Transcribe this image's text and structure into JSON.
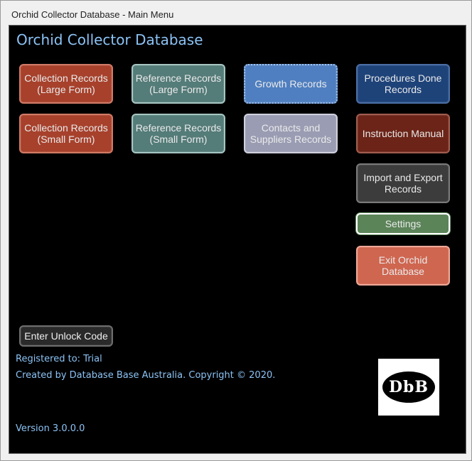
{
  "window": {
    "title": "Orchid Collector Database  - Main Menu"
  },
  "header": {
    "app_title": "Orchid Collector Database"
  },
  "buttons": {
    "collection_large": "Collection Records\n(Large Form)",
    "reference_large": "Reference Records\n(Large Form)",
    "growth": "Growth Records",
    "procedures": "Procedures Done\nRecords",
    "collection_small": "Collection Records\n(Small Form)",
    "reference_small": "Reference Records\n(Small Form)",
    "contacts": "Contacts and\nSuppliers Records",
    "manual": "Instruction Manual",
    "import_export": "Import and Export\nRecords",
    "settings": "Settings",
    "exit": "Exit Orchid\nDatabase",
    "unlock": "Enter Unlock Code"
  },
  "footer": {
    "registered": "Registered to:  Trial",
    "copyright": "Created by Database Base Australia.  Copyright © 2020.",
    "version": "Version 3.0.0.0",
    "logo_text": "DbB"
  },
  "colors": {
    "title_text": "#8cc3f5",
    "background": "#000000",
    "collection": "#a7412c",
    "reference": "#547c79",
    "growth": "#4f7fc0",
    "contacts": "#9a9cb3",
    "procedures": "#1e4379",
    "manual": "#6b2417",
    "import_export": "#3c3c3c",
    "settings": "#5b8459",
    "exit": "#cf6650"
  }
}
